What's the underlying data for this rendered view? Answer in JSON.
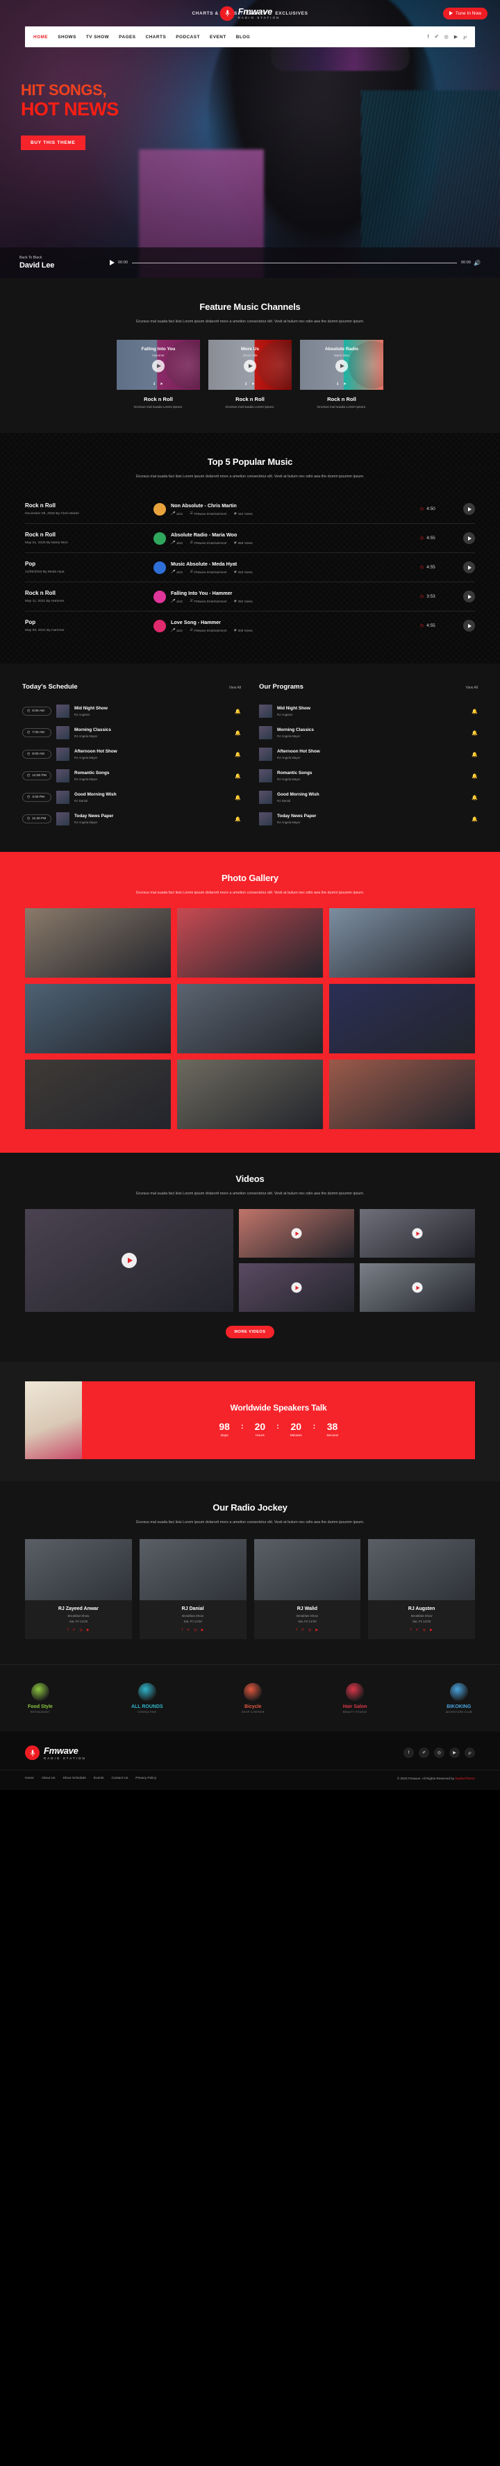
{
  "topbar": {
    "links": [
      "CHARTS & POLLS",
      "EVENTS",
      "EXCLUSIVES"
    ],
    "separator": "I",
    "brand_name": "Fmwave",
    "brand_sub": "RADIO STATION",
    "tune_in": "Tune In Now"
  },
  "nav": {
    "items": [
      "HOME",
      "SHOWS",
      "TV SHOW",
      "PAGES",
      "CHARTS",
      "PODCAST",
      "EVENT",
      "BLOG"
    ],
    "active": "HOME",
    "social": [
      "facebook-icon",
      "twitter-icon",
      "instagram-icon",
      "youtube-icon",
      "pinterest-icon"
    ],
    "social_glyphs": [
      "f",
      "✐",
      "◎",
      "▶",
      "℘"
    ]
  },
  "hero": {
    "line1": "HIT SONGS,",
    "line2": "HOT NEWS",
    "cta": "BUY THIS THEME",
    "accent": "#f5232a"
  },
  "player": {
    "label": "Back To Black",
    "artist": "David Lee",
    "current_time": "00:00",
    "total_time": "00:00"
  },
  "features": {
    "title": "Feature Music Channels",
    "desc": "Grursus mal suada faci lisis Lorem ipsum dolarorit more a ametion consectetur elit. Vesti at bulum nec odio aea the dumm ipsumm ipsum.",
    "cards": [
      {
        "overlay_title": "Falling Into You",
        "overlay_sub": "Hammer",
        "name": "Rock n Roll",
        "desc": "Grursus mal suada Lorem ipsum."
      },
      {
        "overlay_title": "More Us",
        "overlay_sub": "Jhone Alle",
        "name": "Rock n Roll",
        "desc": "Grursus mal suada Lorem ipsum."
      },
      {
        "overlay_title": "Absolute Radio",
        "overlay_sub": "Maria Woo",
        "name": "Rock n Roll",
        "desc": "Grursus mal suada Lorem ipsum."
      }
    ]
  },
  "top5": {
    "title": "Top 5 Popular Music",
    "desc": "Grursus mal suada faci lisis Lorem ipsum dolarorit more a ametion consectetur elit. Vesti at bulum nec odio aea the dumm ipsumm ipsum.",
    "tracks": [
      {
        "genre": "Rock n Roll",
        "date": "December 08, 2020 By Chris Martin",
        "title": "Non Absolute - Chris Martin",
        "tag": "Jazz",
        "label": "FMwave Entertainment",
        "views": "442 Views",
        "duration": "4:50",
        "color": "#e8a33d"
      },
      {
        "genre": "Rock n Roll",
        "date": "May 01, 2020 By Maria Woo",
        "title": "Absolute Radio - Maria Woo",
        "tag": "Jazz",
        "label": "FMwave Entertainment",
        "views": "558 Views",
        "duration": "4:55",
        "color": "#2fa85e"
      },
      {
        "genre": "Pop",
        "date": "12/05/2020 By Meda Hyat",
        "title": "Music Absolute - Meda Hyat",
        "tag": "Jazz",
        "label": "FMwave Entertainment",
        "views": "333 Views",
        "duration": "4:55",
        "color": "#2f6fd8"
      },
      {
        "genre": "Rock n Roll",
        "date": "May 11, 2021 By Hammer",
        "title": "Falling Into You - Hammer",
        "tag": "Jazz",
        "label": "FMwave Entertainment",
        "views": "282 Views",
        "duration": "3:53",
        "color": "#e0359a"
      },
      {
        "genre": "Pop",
        "date": "May 09, 2021 By Hammer",
        "title": "Love Song - Hammer",
        "tag": "Jazz",
        "label": "FMwave Entertainment",
        "views": "309 Views",
        "duration": "4:55",
        "color": "#e22a6e"
      }
    ]
  },
  "schedule": {
    "title": "Today's Schedule",
    "view_all": "View All",
    "items": [
      {
        "time": "6:00 AM",
        "name": "Mid Night Show",
        "rj": "RJ Augsten"
      },
      {
        "time": "7:30 AM",
        "name": "Morning Classics",
        "rj": "RJ Angela Mayer"
      },
      {
        "time": "9:00 AM",
        "name": "Afternoon Hot Show",
        "rj": "RJ Angela Mayer"
      },
      {
        "time": "12:00 PM",
        "name": "Romantic Songs",
        "rj": "RJ Angela Mayer"
      },
      {
        "time": "3:30 PM",
        "name": "Good Morning Wish",
        "rj": "RJ Danial"
      },
      {
        "time": "11:30 PM",
        "name": "Today News Paper",
        "rj": "RJ Angela Mayer"
      }
    ]
  },
  "programs": {
    "title": "Our Programs",
    "view_all": "View All",
    "items": [
      {
        "name": "Mid Night Show",
        "rj": "RJ Augsten"
      },
      {
        "name": "Morning Classics",
        "rj": "RJ Angela Mayer"
      },
      {
        "name": "Afternoon Hot Show",
        "rj": "RJ Angela Mayer"
      },
      {
        "name": "Romantic Songs",
        "rj": "RJ Angela Mayer"
      },
      {
        "name": "Good Morning Wish",
        "rj": "RJ Danial"
      },
      {
        "name": "Today News Paper",
        "rj": "RJ Angela Mayer"
      }
    ]
  },
  "gallery": {
    "title": "Photo Gallery",
    "desc": "Grursus mal suada faci lisis Lorem ipsum dolarorit more a ametion consectetur elit. Vesti at bulum nec odio aea the dumm ipsumm ipsum.",
    "tiles": [
      "#8a7a6a",
      "#c74a52",
      "#7c8ea0",
      "#4d6274",
      "#5a6470",
      "#2b2f55",
      "#3f3a36",
      "#6d6a5e",
      "#9a5a4a"
    ]
  },
  "videos": {
    "title": "Videos",
    "desc": "Grursus mal suada faci lisis Lorem ipsum dolarorit more a ametion consectetur elit. Vesti at bulum nec odio aea the dumm ipsumm ipsum.",
    "more": "MORE VIDEOS",
    "tiles": [
      "#4a4250",
      "#c0756a",
      "#6f6f7a",
      "#5a4a62",
      "#7a8088"
    ]
  },
  "countdown": {
    "title": "Worldwide Speakers Talk",
    "units": [
      {
        "value": "98",
        "label": "Days"
      },
      {
        "value": "20",
        "label": "Hours"
      },
      {
        "value": "20",
        "label": "Minutes"
      },
      {
        "value": "38",
        "label": "Second"
      }
    ],
    "separator": ":"
  },
  "jockeys": {
    "title": "Our Radio Jockey",
    "desc": "Grursus mal suada faci lisis Lorem ipsum dolarorit more a ametion consectetur elit. Vesti at bulum nec odio aea the dumm ipsumm ipsum.",
    "people": [
      {
        "name": "RJ Zayeed Anwar",
        "role": "Breakfast Show",
        "time": "Sat, Fri 13:00"
      },
      {
        "name": "RJ Danial",
        "role": "Breakfast Show",
        "time": "Sat, Fri 13:00"
      },
      {
        "name": "RJ Walid",
        "role": "Breakfast Show",
        "time": "Sat, Fri 13:00"
      },
      {
        "name": "RJ Augsten",
        "role": "Breakfast Show",
        "time": "Sat, Fri 13:00"
      }
    ],
    "social_glyphs": [
      "f",
      "✐",
      "◎",
      "▶"
    ]
  },
  "brands": [
    {
      "name": "Food Style",
      "sub": "RESTAURANT",
      "color": "#8cc63f"
    },
    {
      "name": "ALL ROUNDS",
      "sub": "CONSULTING",
      "color": "#2fb3c9"
    },
    {
      "name": "Bicycle",
      "sub": "SHOP & REPAIR",
      "color": "#e0573e"
    },
    {
      "name": "Hair Salon",
      "sub": "BEAUTY STUDIO",
      "color": "#d8374a"
    },
    {
      "name": "BIKOKING",
      "sub": "ADVENTURE CLUB",
      "color": "#4aa3dd"
    }
  ],
  "footer": {
    "brand_name": "Fmwave",
    "brand_sub": "RADIO STATION",
    "social_glyphs": [
      "f",
      "✐",
      "◎",
      "▶",
      "℘"
    ],
    "links": [
      "Home",
      "About Us",
      "Show Schedule",
      "Events",
      "Contact Us",
      "Privacy Policy"
    ],
    "copyright_prefix": "© 2023 Fmwave. All Rights Reserved by ",
    "copyright_brand": "RadiusTheme"
  }
}
